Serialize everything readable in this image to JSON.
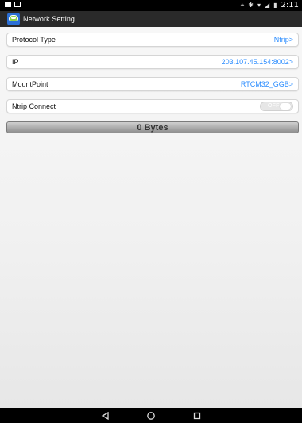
{
  "status_bar": {
    "time": "2:11",
    "icons": [
      "notification-icon",
      "notification-icon",
      "location-icon",
      "bluetooth-icon",
      "wifi-icon",
      "signal-icon",
      "battery-icon"
    ]
  },
  "app": {
    "title": "Network Setting"
  },
  "settings": {
    "protocol_type": {
      "label": "Protocol Type",
      "value": "Ntrip"
    },
    "ip": {
      "label": "IP",
      "value": "203.107.45.154:8002"
    },
    "mount_point": {
      "label": "MountPoint",
      "value": "RTCM32_GGB"
    },
    "ntrip_connect": {
      "label": "Ntrip Connect",
      "state": "OFF"
    }
  },
  "data_counter": {
    "text": "0 Bytes"
  },
  "nav": {
    "buttons": [
      "back-icon",
      "home-icon",
      "recent-apps-icon"
    ]
  },
  "colors": {
    "accent": "#2a8cff",
    "app_bar": "#2a2a2a",
    "status_bar": "#000000"
  }
}
